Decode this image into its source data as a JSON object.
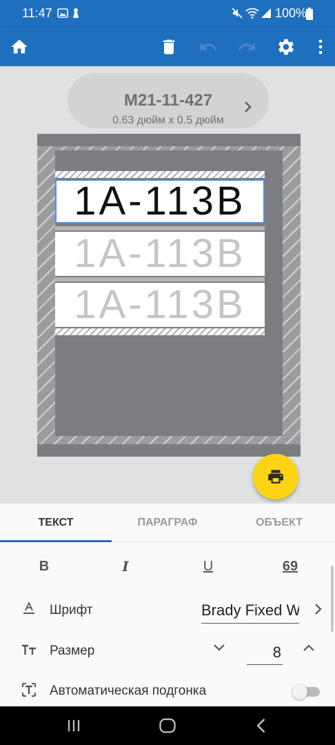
{
  "status_bar": {
    "time": "11:47",
    "battery": "100%"
  },
  "toolbar": {
    "icons": [
      "home-icon",
      "trash-icon",
      "undo-icon",
      "redo-icon",
      "gear-icon",
      "more-vert-icon"
    ],
    "color": "#1f6fbf"
  },
  "label": {
    "part_number": "M21-11-427",
    "dimensions": "0.63 дюйм x 0.5 дюйм"
  },
  "tiles": [
    {
      "text": "1A-113B",
      "state": "selected"
    },
    {
      "text": "1A-113B",
      "state": "inactive"
    },
    {
      "text": "1A-113B",
      "state": "inactive"
    }
  ],
  "tabs": {
    "text": "ТЕКСТ",
    "paragraph": "ПАРАГРАФ",
    "object": "ОБЪЕКТ",
    "active": "text"
  },
  "format": {
    "bold": "B",
    "italic": "I",
    "underline": "U",
    "numbering": "69"
  },
  "font_row": {
    "label": "Шрифт",
    "value": "Brady Fixed Width"
  },
  "size_row": {
    "label": "Размер",
    "value": "8"
  },
  "autofit_row": {
    "label": "Автоматическая подгонка",
    "enabled": false
  },
  "colors": {
    "accent": "#1f6fbf",
    "print_fab": "#fcd413",
    "selection": "#4a90d9"
  }
}
